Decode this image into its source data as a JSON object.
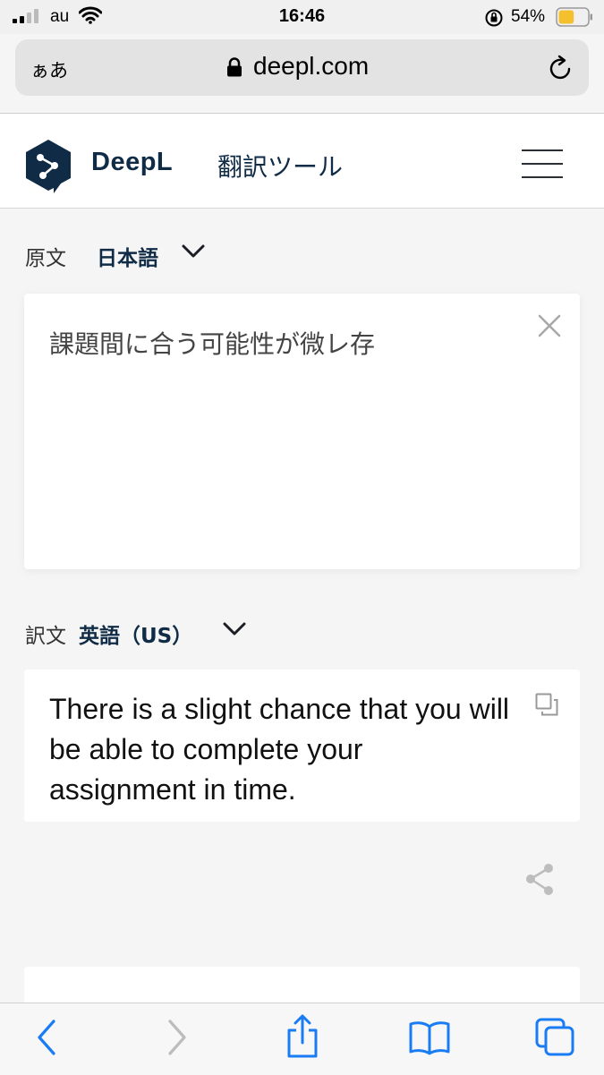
{
  "status_bar": {
    "carrier": "au",
    "time": "16:46",
    "battery_percent": "54%",
    "battery_level": 0.54,
    "icons": [
      "signal-icon",
      "wifi-icon",
      "orientation-lock-icon",
      "battery-icon"
    ]
  },
  "browser": {
    "text_size_button": "ぁあ",
    "url": "deepl.com",
    "icons": [
      "lock-icon",
      "reload-icon"
    ]
  },
  "header": {
    "brand": "DeepL",
    "tool_title": "翻訳ツール",
    "icons": [
      "deepl-logo-icon",
      "hamburger-menu-icon"
    ]
  },
  "source": {
    "label": "原文",
    "language": "日本語",
    "text": "課題間に合う可能性が微レ存",
    "icons": [
      "chevron-down-icon",
      "close-icon"
    ]
  },
  "target": {
    "label": "訳文",
    "language": "英語（US）",
    "text": "There is a slight chance that you will be able to complete your assignment in time.",
    "icons": [
      "chevron-down-icon",
      "copy-icon",
      "share-icon"
    ]
  },
  "toolbar": {
    "icons": [
      "back-icon",
      "forward-icon",
      "share-sheet-icon",
      "bookmarks-icon",
      "tabs-icon"
    ]
  },
  "colors": {
    "brand_navy": "#0f2b46",
    "page_bg": "#f5f5f5",
    "ios_blue": "#1a7cf5"
  }
}
